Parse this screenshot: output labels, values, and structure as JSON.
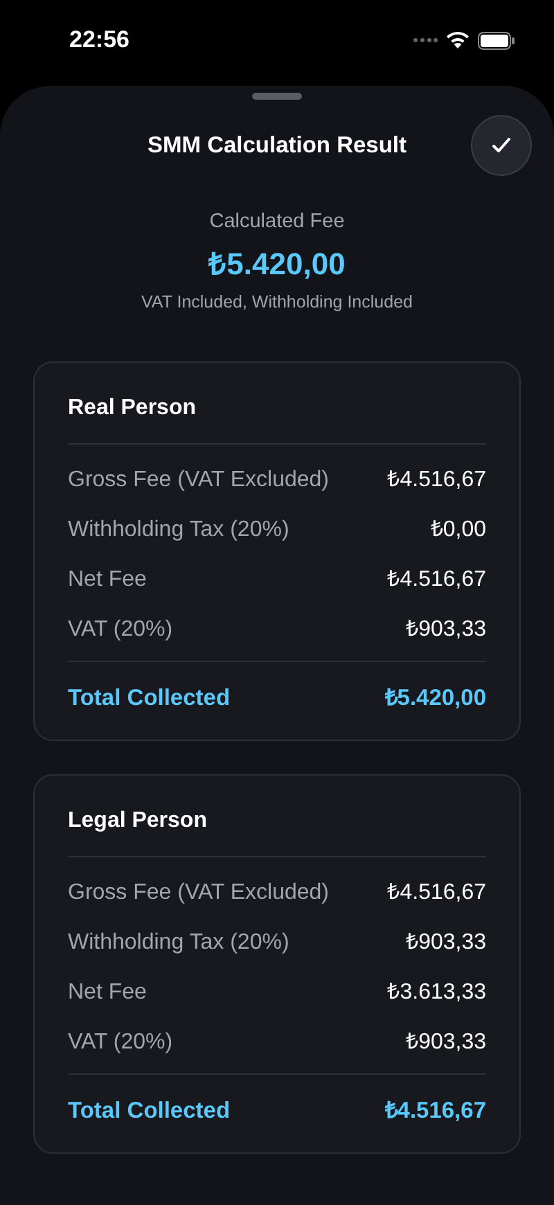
{
  "status_bar": {
    "time": "22:56"
  },
  "sheet": {
    "title": "SMM Calculation Result"
  },
  "summary": {
    "label": "Calculated Fee",
    "amount": "₺5.420,00",
    "note": "VAT Included, Withholding Included"
  },
  "cards": [
    {
      "title": "Real Person",
      "rows": [
        {
          "label": "Gross Fee (VAT Excluded)",
          "value": "₺4.516,67"
        },
        {
          "label": "Withholding Tax (20%)",
          "value": "₺0,00"
        },
        {
          "label": "Net Fee",
          "value": "₺4.516,67"
        },
        {
          "label": "VAT (20%)",
          "value": "₺903,33"
        }
      ],
      "total": {
        "label": "Total Collected",
        "value": "₺5.420,00"
      }
    },
    {
      "title": "Legal Person",
      "rows": [
        {
          "label": "Gross Fee (VAT Excluded)",
          "value": "₺4.516,67"
        },
        {
          "label": "Withholding Tax (20%)",
          "value": "₺903,33"
        },
        {
          "label": "Net Fee",
          "value": "₺3.613,33"
        },
        {
          "label": "VAT (20%)",
          "value": "₺903,33"
        }
      ],
      "total": {
        "label": "Total Collected",
        "value": "₺4.516,67"
      }
    }
  ]
}
